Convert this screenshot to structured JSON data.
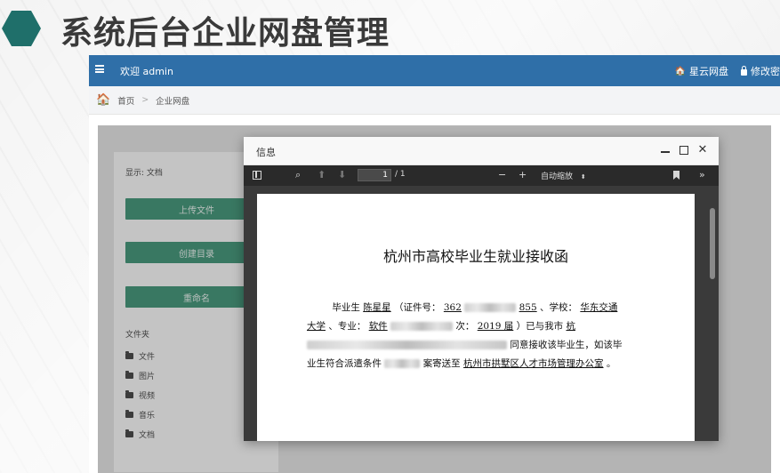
{
  "slide": {
    "title": "系统后台企业网盘管理"
  },
  "topbar": {
    "welcome": "欢迎 admin",
    "nav_home": "星云网盘",
    "nav_password": "修改密"
  },
  "breadcrumb": {
    "home": "首页",
    "separator": ">",
    "current": "企业网盘"
  },
  "sidebar": {
    "show_label": "显示: 文档",
    "buttons": [
      "上传文件",
      "创建目录",
      "重命名"
    ],
    "folder_header": "文件夹",
    "folders": [
      "文件",
      "图片",
      "视频",
      "音乐",
      "文档"
    ]
  },
  "modal": {
    "title": "信息",
    "controls": {
      "close": "✕"
    }
  },
  "pdf_viewer": {
    "page_current": "1",
    "page_total": "/ 1",
    "zoom": "自动缩放",
    "zoom_out": "−",
    "zoom_in": "+"
  },
  "document": {
    "title": "杭州市高校毕业生就业接收函",
    "line1_a": "毕业生",
    "name": "陈星星",
    "line1_b": "（证件号：",
    "id_prefix": "362",
    "id_suffix": "855",
    "line1_c": "、学校：",
    "school_a": "华东交通",
    "line2_a": "大学",
    "line2_b": "、专业：",
    "major": "软件",
    "line2_c": "次：",
    "year": "2019 届",
    "line2_d": "）已与我市",
    "city": "杭",
    "line3_a": "同意接收该毕业生，如该毕",
    "line4_a": "业生符合派遣条件",
    "line4_b": "案寄送至",
    "destination": "杭州市拱墅区人才市场管理办公室",
    "line4_end": "。"
  }
}
